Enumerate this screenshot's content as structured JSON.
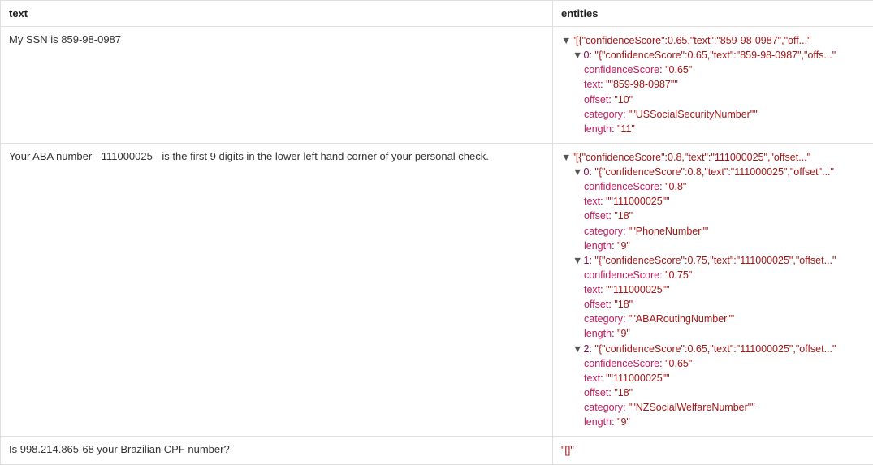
{
  "columns": {
    "text": "text",
    "entities": "entities"
  },
  "rows": [
    {
      "text": "My SSN is 859-98-0987",
      "summary": "\"[{\"confidenceScore\":0.65,\"text\":\"859-98-0987\",\"off...\"",
      "items": [
        {
          "index": "0",
          "summary": "\"{\"confidenceScore\":0.65,\"text\":\"859-98-0987\",\"offs...\"",
          "props": {
            "confidenceScore": "\"0.65\"",
            "text": "\"\"859-98-0987\"\"",
            "offset": "\"10\"",
            "category": "\"\"USSocialSecurityNumber\"\"",
            "length": "\"11\""
          }
        }
      ]
    },
    {
      "text": "Your ABA number - 111000025 - is the first 9 digits in the lower left hand corner of your personal check.",
      "summary": "\"[{\"confidenceScore\":0.8,\"text\":\"111000025\",\"offset...\"",
      "items": [
        {
          "index": "0",
          "summary": "\"{\"confidenceScore\":0.8,\"text\":\"111000025\",\"offset\"...\"",
          "props": {
            "confidenceScore": "\"0.8\"",
            "text": "\"\"111000025\"\"",
            "offset": "\"18\"",
            "category": "\"\"PhoneNumber\"\"",
            "length": "\"9\""
          }
        },
        {
          "index": "1",
          "summary": "\"{\"confidenceScore\":0.75,\"text\":\"111000025\",\"offset...\"",
          "props": {
            "confidenceScore": "\"0.75\"",
            "text": "\"\"111000025\"\"",
            "offset": "\"18\"",
            "category": "\"\"ABARoutingNumber\"\"",
            "length": "\"9\""
          }
        },
        {
          "index": "2",
          "summary": "\"{\"confidenceScore\":0.65,\"text\":\"111000025\",\"offset...\"",
          "props": {
            "confidenceScore": "\"0.65\"",
            "text": "\"\"111000025\"\"",
            "offset": "\"18\"",
            "category": "\"\"NZSocialWelfareNumber\"\"",
            "length": "\"9\""
          }
        }
      ]
    },
    {
      "text": "Is 998.214.865-68 your Brazilian CPF number?",
      "summary": "\"[]\"",
      "items": []
    }
  ]
}
